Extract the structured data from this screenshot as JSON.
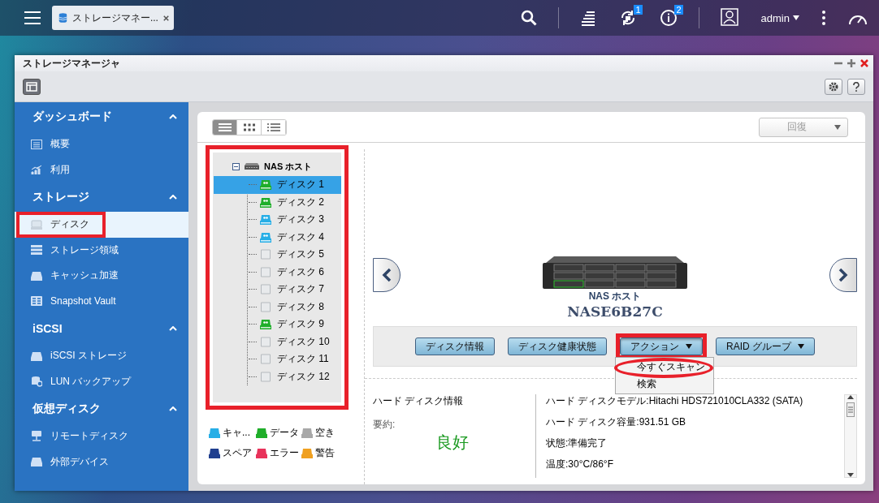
{
  "top_bar": {
    "tab": {
      "label": "ストレージマネー..."
    },
    "badges": [
      {
        "kind": "sync",
        "count": "1"
      },
      {
        "kind": "info",
        "count": "2"
      }
    ],
    "user": "admin"
  },
  "window": {
    "title": "ストレージマネージャ"
  },
  "sidebar": {
    "sections": [
      {
        "title": "ダッシュボード",
        "expanded": true,
        "items": [
          {
            "label": "概要",
            "kind": "overview",
            "selected": false,
            "highlighted": false
          },
          {
            "label": "利用",
            "kind": "chart",
            "selected": false,
            "highlighted": false
          }
        ]
      },
      {
        "title": "ストレージ",
        "expanded": true,
        "items": [
          {
            "label": "ディスク",
            "kind": "disk",
            "selected": true,
            "highlighted": true
          },
          {
            "label": "ストレージ領域",
            "kind": "stack",
            "selected": false,
            "highlighted": false
          },
          {
            "label": "キャッシュ加速",
            "kind": "drive",
            "selected": false,
            "highlighted": false
          },
          {
            "label": "Snapshot Vault",
            "kind": "grid",
            "selected": false,
            "highlighted": false
          }
        ]
      },
      {
        "title": "iSCSI",
        "expanded": true,
        "items": [
          {
            "label": "iSCSI ストレージ",
            "kind": "drive",
            "selected": false,
            "highlighted": false
          },
          {
            "label": "LUN バックアップ",
            "kind": "db",
            "selected": false,
            "highlighted": false
          }
        ]
      },
      {
        "title": "仮想ディスク",
        "expanded": true,
        "items": [
          {
            "label": "リモートディスク",
            "kind": "remote",
            "selected": false,
            "highlighted": false
          },
          {
            "label": "外部デバイス",
            "kind": "drive",
            "selected": false,
            "highlighted": false
          }
        ]
      }
    ]
  },
  "view_modes": [
    {
      "kind": "list",
      "selected": true
    },
    {
      "kind": "grid",
      "selected": false
    },
    {
      "kind": "detail",
      "selected": false
    }
  ],
  "restore_dropdown": {
    "label": "回復",
    "disabled": true
  },
  "tree": {
    "highlighted": true,
    "root": {
      "label": "NAS ホスト",
      "expanded": true,
      "children": [
        {
          "label": "ディスク 1",
          "kind": "data",
          "selected": true
        },
        {
          "label": "ディスク 2",
          "kind": "data",
          "selected": false
        },
        {
          "label": "ディスク 3",
          "kind": "cache",
          "selected": false
        },
        {
          "label": "ディスク 4",
          "kind": "cache",
          "selected": false
        },
        {
          "label": "ディスク 5",
          "kind": "free",
          "selected": false
        },
        {
          "label": "ディスク 6",
          "kind": "free",
          "selected": false
        },
        {
          "label": "ディスク 7",
          "kind": "free",
          "selected": false
        },
        {
          "label": "ディスク 8",
          "kind": "free",
          "selected": false
        },
        {
          "label": "ディスク 9",
          "kind": "data",
          "selected": false
        },
        {
          "label": "ディスク 10",
          "kind": "free",
          "selected": false
        },
        {
          "label": "ディスク 11",
          "kind": "free",
          "selected": false
        },
        {
          "label": "ディスク 12",
          "kind": "free",
          "selected": false
        }
      ]
    }
  },
  "legend": [
    {
      "label": "キャ...",
      "color": "#27aee6"
    },
    {
      "label": "データ",
      "color": "#1fae2a"
    },
    {
      "label": "空き",
      "color": "#a8a8a8"
    },
    {
      "label": "スペア",
      "color": "#1f3f8f"
    },
    {
      "label": "エラー",
      "color": "#e8325a"
    },
    {
      "label": "警告",
      "color": "#f0a020"
    }
  ],
  "device": {
    "caption": "NAS ホスト",
    "name": "NASE6B27C"
  },
  "actions": [
    {
      "label": "ディスク情報",
      "dropdown": false,
      "highlighted": false
    },
    {
      "label": "ディスク健康状態",
      "dropdown": false,
      "highlighted": false
    },
    {
      "label": "アクション",
      "dropdown": true,
      "highlighted": true,
      "expanded": true,
      "menu": [
        {
          "label": "今すぐスキャン",
          "highlighted": true
        },
        {
          "label": "検索",
          "highlighted": false
        }
      ]
    },
    {
      "label": "RAID グループ",
      "dropdown": true,
      "highlighted": false,
      "expanded": false
    }
  ],
  "info": {
    "title": "ハード ディスク情報",
    "summary_label": "要約:",
    "summary": "良好",
    "fields": [
      {
        "label": "ハード ディスクモデル:",
        "value": "Hitachi HDS721010CLA332 (SATA)"
      },
      {
        "label": "ハード ディスク容量:",
        "value": "931.51 GB"
      },
      {
        "label": "状態:",
        "value": "準備完了"
      },
      {
        "label": "温度:",
        "value": "30°C/86°F"
      }
    ]
  }
}
